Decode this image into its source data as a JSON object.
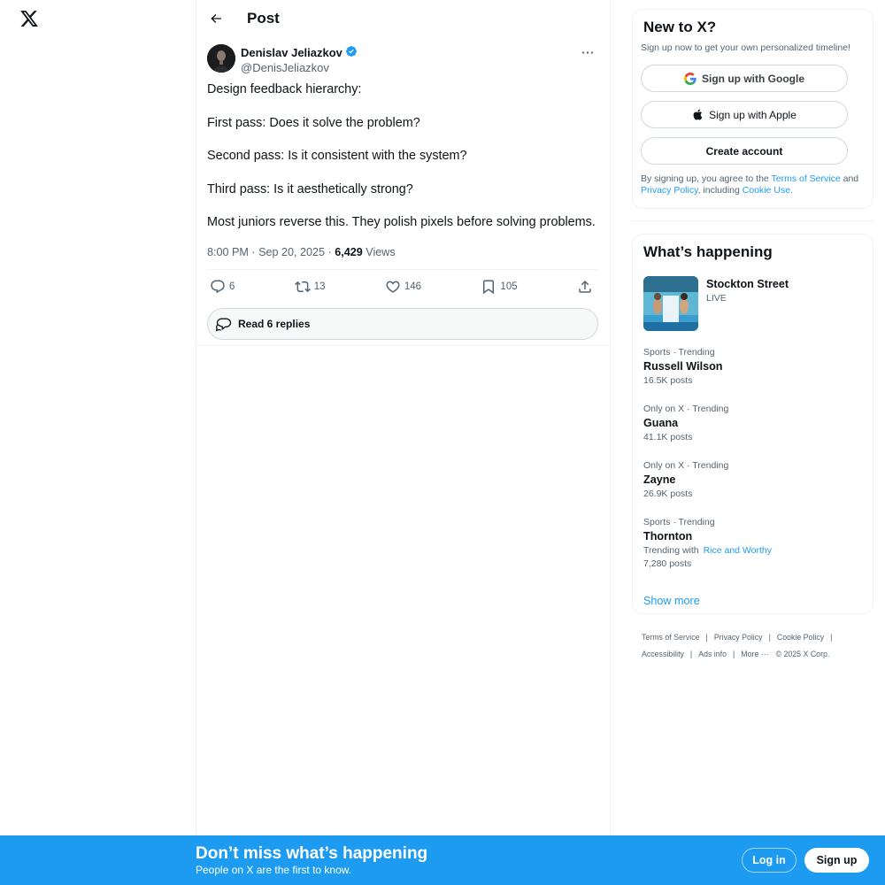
{
  "header": {
    "title": "Post"
  },
  "post": {
    "author_name": "Denislav Jeliazkov",
    "author_handle": "@DenisJeliazkov",
    "lines": [
      "Design feedback hierarchy:",
      "First pass: Does it solve the problem?",
      "Second pass: Is it consistent with the system?",
      "Third pass: Is it aesthetically strong?",
      "Most juniors reverse this. They polish pixels before solving problems."
    ],
    "time": "8:00 PM",
    "date": "Sep 20, 2025",
    "views_count": "6,429",
    "views_label": "Views",
    "replies": "6",
    "reposts": "13",
    "likes": "146",
    "bookmarks": "105",
    "read_replies": "Read 6 replies"
  },
  "signup": {
    "title": "New to X?",
    "subtitle": "Sign up now to get your own personalized timeline!",
    "google": "Sign up with Google",
    "apple": "Sign up with Apple",
    "create": "Create account",
    "legal_prefix": "By signing up, you agree to the",
    "terms": "Terms of Service",
    "and": "and",
    "privacy": "Privacy Policy",
    "including": ", including",
    "cookie": "Cookie Use."
  },
  "trends": {
    "title": "What’s happening",
    "featured_title": "Stockton Street",
    "featured_status": "LIVE",
    "items": [
      {
        "context": "Sports · Trending",
        "name": "Russell Wilson",
        "count": "16.5K posts"
      },
      {
        "context": "Only on X · Trending",
        "name": "Guana",
        "count": "41.1K posts"
      },
      {
        "context": "Only on X · Trending",
        "name": "Zayne",
        "count": "26.9K posts"
      },
      {
        "context": "Sports · Trending",
        "name": "Thornton",
        "with_label": "Trending with",
        "with_link": "Rice and Worthy",
        "count": "7,280 posts"
      }
    ],
    "show_more": "Show more"
  },
  "footer": {
    "terms": "Terms of Service",
    "privacy": "Privacy Policy",
    "cookie": "Cookie Policy",
    "accessibility": "Accessibility",
    "ads": "Ads info",
    "more": "More ···",
    "copyright": "© 2025 X Corp."
  },
  "banner": {
    "title": "Don’t miss what’s happening",
    "subtitle": "People on X are the first to know.",
    "login": "Log in",
    "signup": "Sign up"
  },
  "colors": {
    "accent": "#1d9bf0",
    "text": "#0f1419",
    "muted": "#536471"
  }
}
